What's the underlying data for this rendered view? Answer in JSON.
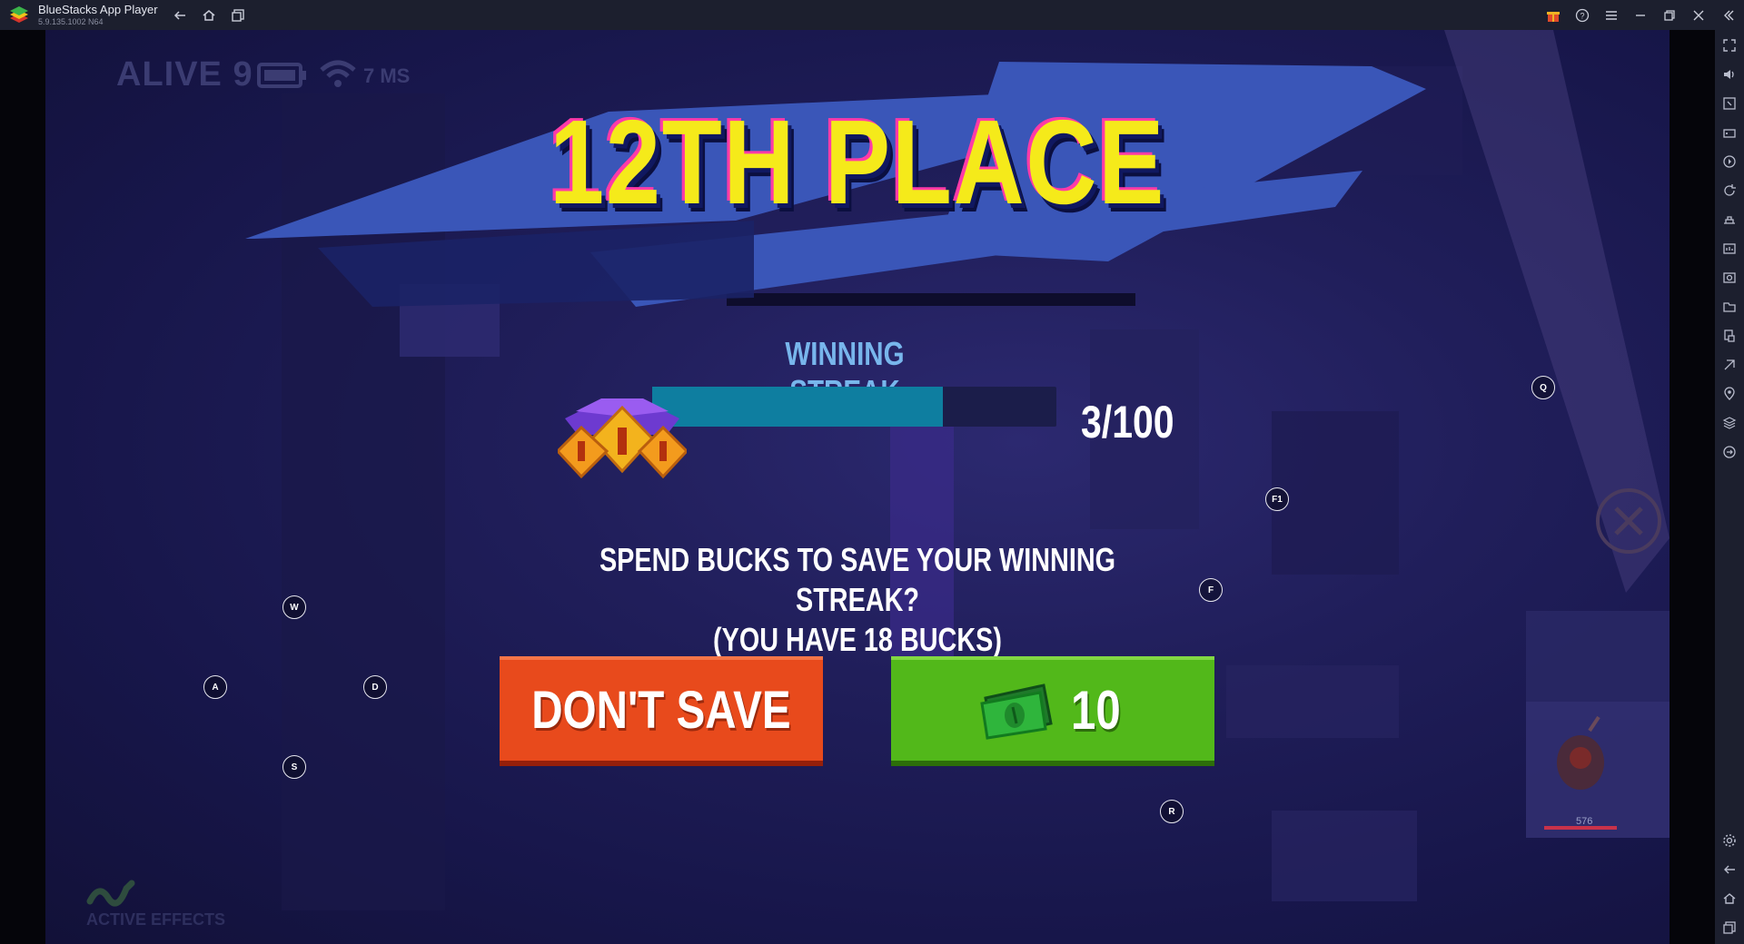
{
  "window": {
    "app_name": "BlueStacks App Player",
    "version": "5.9.135.1002  N64"
  },
  "hud": {
    "alive_label": "ALIVE 9",
    "ping": "7 MS",
    "active_effects": "ACTIVE EFFECTS"
  },
  "result": {
    "title": "12TH PLACE",
    "streak_label": "WINNING STREAK",
    "streak_count": "3/100",
    "streak_progress_fraction": 0.72,
    "question_line1": "SPEND BUCKS TO SAVE YOUR WINNING STREAK?",
    "question_line2": "(YOU HAVE 18 BUCKS)",
    "dont_save_label": "DON'T SAVE",
    "save_price": "10"
  },
  "key_hints": {
    "w": "W",
    "a": "A",
    "s": "S",
    "d": "D",
    "q": "Q",
    "f1": "F1",
    "f": "F",
    "r": "R"
  },
  "minibar": {
    "value": "576"
  },
  "colors": {
    "title_yellow": "#f5ea1a",
    "dont_save_red": "#e84a1c",
    "save_green": "#52b81a",
    "streak_fill": "#0e7ea0"
  },
  "icons": {
    "titlebar": [
      "back-icon",
      "home-icon",
      "multi-window-icon",
      "gift-icon",
      "help-icon",
      "menu-icon",
      "minimize-icon",
      "restore-icon",
      "close-icon",
      "collapse-sidebar-icon"
    ],
    "sidebar": [
      "fullscreen-icon",
      "volume-icon",
      "keyboard-icon",
      "gamepad-icon",
      "macro-icon",
      "rotate-icon",
      "screenshot-icon",
      "record-icon",
      "camera-icon",
      "folder-icon",
      "apk-icon",
      "eco-mode-icon",
      "location-icon",
      "layers-icon",
      "sync-icon",
      "settings-icon",
      "back-nav-icon",
      "home-nav-icon",
      "recent-apps-icon"
    ]
  }
}
